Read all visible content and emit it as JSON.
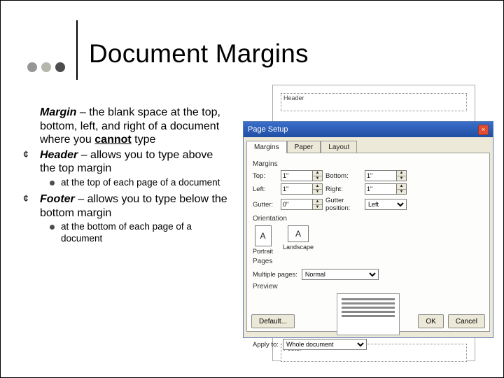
{
  "title": "Document Margins",
  "body": {
    "margin": {
      "term": "Margin",
      "def1": " – the blank space at the top, bottom, left, and right of a document where you ",
      "cannot": "cannot",
      "def2": " type"
    },
    "header": {
      "term": "Header",
      "def": " – allows you to type above the top margin",
      "sub": "at the top of each page of a document"
    },
    "footer": {
      "term": "Footer",
      "def": " – allows you to type below the bottom margin",
      "sub": "at the bottom of each page of a document"
    }
  },
  "shot": {
    "header_label": "Header",
    "footer_label": "Footer"
  },
  "dialog": {
    "title": "Page Setup",
    "tabs": [
      "Margins",
      "Paper",
      "Layout"
    ],
    "groups": {
      "margins": "Margins",
      "orientation": "Orientation",
      "pages": "Pages",
      "preview": "Preview"
    },
    "fields": {
      "top": "Top:",
      "bottom": "Bottom:",
      "left": "Left:",
      "right": "Right:",
      "gutter": "Gutter:",
      "gutter_pos": "Gutter position:",
      "multiple_pages": "Multiple pages:",
      "apply_to": "Apply to:"
    },
    "values": {
      "top": "1\"",
      "bottom": "1\"",
      "left": "1\"",
      "right": "1\"",
      "gutter": "0\"",
      "gutter_pos": "Left",
      "multiple_pages": "Normal",
      "apply_to": "Whole document"
    },
    "orientation": {
      "portrait": "Portrait",
      "landscape": "Landscape"
    },
    "buttons": {
      "default": "Default...",
      "ok": "OK",
      "cancel": "Cancel"
    }
  }
}
